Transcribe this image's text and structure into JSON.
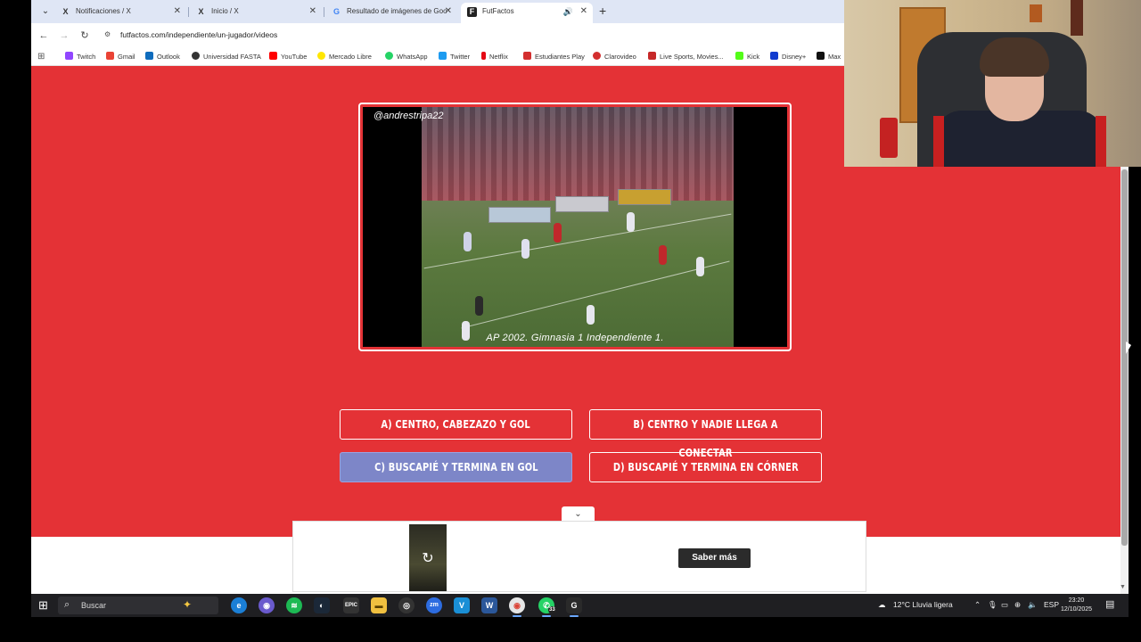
{
  "browser": {
    "tabs": [
      {
        "label": "Notificaciones / X",
        "favicon": "X",
        "active": false
      },
      {
        "label": "Inicio / X",
        "favicon": "X",
        "active": false
      },
      {
        "label": "Resultado de imágenes de Goo",
        "favicon": "G",
        "active": false
      },
      {
        "label": "FutFactos",
        "favicon": "F",
        "active": true
      }
    ],
    "url": "futfactos.com/independiente/un-jugador/videos",
    "bookmarks": [
      {
        "label": "Twitch",
        "color": "#9146ff"
      },
      {
        "label": "Gmail",
        "color": "#ea4335"
      },
      {
        "label": "Outlook",
        "color": "#0f6cbd"
      },
      {
        "label": "Universidad FASTA",
        "color": "#333333"
      },
      {
        "label": "YouTube",
        "color": "#ff0000"
      },
      {
        "label": "Mercado Libre",
        "color": "#ffe600"
      },
      {
        "label": "WhatsApp",
        "color": "#25d366"
      },
      {
        "label": "Twitter",
        "color": "#1d9bf0"
      },
      {
        "label": "Netflix",
        "color": "#e50914"
      },
      {
        "label": "Estudiantes Play",
        "color": "#d32f2f"
      },
      {
        "label": "Clarovideo",
        "color": "#d32f2f"
      },
      {
        "label": "Live Sports, Movies...",
        "color": "#c62828"
      },
      {
        "label": "Kick",
        "color": "#53fc18"
      },
      {
        "label": "Disney+",
        "color": "#113ccf"
      },
      {
        "label": "Max",
        "color": "#111111"
      }
    ]
  },
  "video": {
    "handle": "@andrestripa22",
    "caption": "AP 2002. Gimnasia 1 Independiente 1."
  },
  "quiz": {
    "options": [
      {
        "label": "A) CENTRO, CABEZAZO Y GOL",
        "selected": false
      },
      {
        "label": "B) CENTRO Y NADIE LLEGA A CONECTAR",
        "selected": false
      },
      {
        "label": "C) BUSCAPIÉ Y TERMINA EN GOL",
        "selected": true
      },
      {
        "label": "D) BUSCAPIÉ Y TERMINA EN CÓRNER",
        "selected": false
      }
    ]
  },
  "ad": {
    "cta": "Saber más"
  },
  "taskbar": {
    "search_placeholder": "Buscar",
    "whatsapp_badge": "33",
    "weather": "12°C  Lluvia ligera",
    "language": "ESP",
    "time": "23:20",
    "date": "12/10/2025"
  },
  "colors": {
    "page_bg": "#e43236",
    "selected_option": "#7d86c8"
  }
}
